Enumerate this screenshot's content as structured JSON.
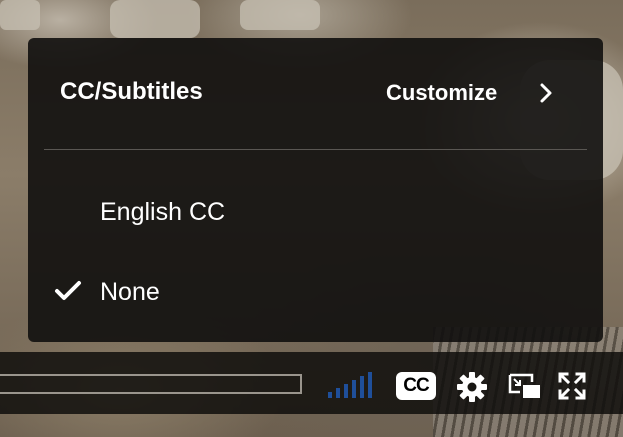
{
  "cc_menu": {
    "title": "CC/Subtitles",
    "customize_label": "Customize",
    "options": [
      {
        "label": "English CC",
        "selected": false
      },
      {
        "label": "None",
        "selected": true
      }
    ]
  },
  "player_controls": {
    "cc_button_label": "CC",
    "icons": [
      "signal-strength-icon",
      "gear-icon",
      "picture-in-picture-icon",
      "fullscreen-icon"
    ]
  },
  "colors": {
    "menu_background": "#11100e",
    "text": "#ffffff",
    "signal_bars": "#1f4f9a"
  }
}
